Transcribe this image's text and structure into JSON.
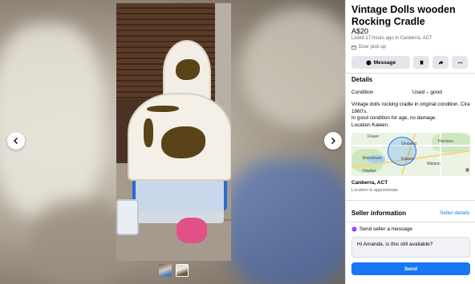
{
  "listing": {
    "title": "Vintage Dolls wooden Rocking Cradle",
    "price": "A$20",
    "listed": "Listed 17 hours ago in Canberra, ACT",
    "pickup": "Door pick-up"
  },
  "actions": {
    "message_label": "Message"
  },
  "details": {
    "heading": "Details",
    "condition_label": "Condition",
    "condition_value": "Used – good",
    "description": "Vintage dolls rocking cradle in original condition. Cira 1960's.\nIn good condition for age, no damage.\nLocation Kaleen."
  },
  "map": {
    "labels": {
      "fraser": "Fraser",
      "giralang": "Giralang",
      "harrison": "Harrison",
      "belconnen": "Belconnen",
      "kaleen": "Kaleen",
      "watson": "Watson",
      "hawker": "Hawker"
    }
  },
  "location": {
    "name": "Canberra, ACT",
    "note": "Location is approximate"
  },
  "seller": {
    "heading": "Seller information",
    "details_link": "Seller details",
    "send_heading": "Send seller a message",
    "message_value": "Hi Amanda, is this still available?",
    "send_label": "Send"
  },
  "colors": {
    "accent": "#1877f2",
    "secondary_text": "#65676b",
    "button_bg": "#e4e6eb"
  }
}
